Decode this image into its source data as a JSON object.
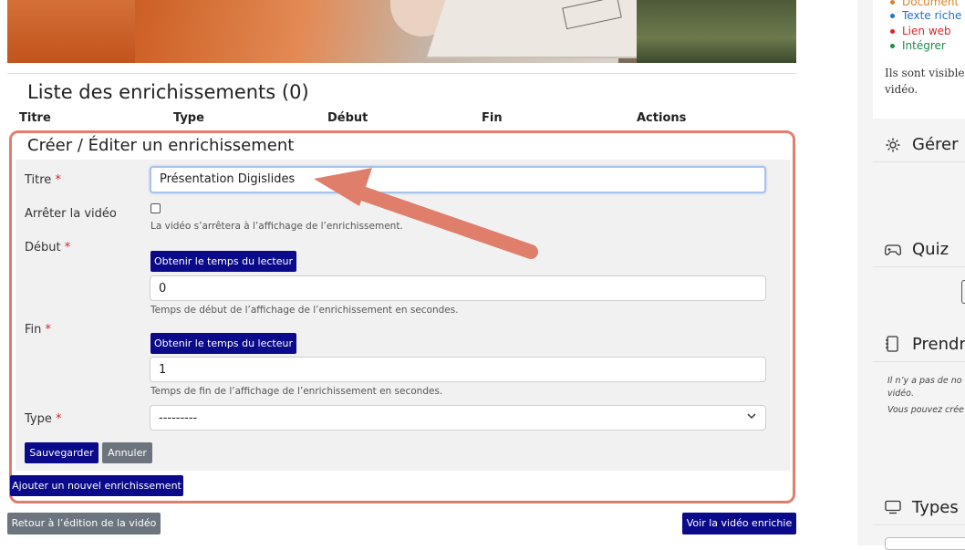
{
  "enrichments_list": {
    "title": "Liste des enrichissements (0)",
    "columns": [
      "Titre",
      "Type",
      "Début",
      "Fin",
      "Actions"
    ]
  },
  "form": {
    "title": "Créer / Éditer un enrichissement",
    "required_mark": "*",
    "titre_label": "Titre",
    "titre_value": "Présentation Digislides",
    "stop_video_label": "Arrêter la vidéo",
    "stop_video_help": "La vidéo s’arrêtera à l’affichage de l’enrichissement.",
    "debut_label": "Début",
    "get_time_label": "Obtenir le temps du lecteur",
    "debut_value": "0",
    "debut_help": "Temps de début de l’affichage de l’enrichissement en secondes.",
    "fin_label": "Fin",
    "fin_value": "1",
    "fin_help": "Temps de fin de l’affichage de l’enrichissement en secondes.",
    "type_label": "Type",
    "type_value": "---------",
    "save_label": "Sauvegarder",
    "cancel_label": "Annuler"
  },
  "add_enrichment_label": "Ajouter un nouvel enrichissement",
  "back_label": "Retour à l’édition de la vidéo",
  "view_enriched_label": "Voir la vidéo enrichie",
  "sidebar": {
    "legend": [
      {
        "label": "Document",
        "color": "#d9822b"
      },
      {
        "label": "Texte riche",
        "color": "#1f6fd1"
      },
      {
        "label": "Lien web",
        "color": "#d9232d"
      },
      {
        "label": "Intégrer",
        "color": "#1e8a4f"
      }
    ],
    "visible_text_1": "Ils sont visible",
    "visible_text_2": "vidéo.",
    "manage_heading": "Gérer",
    "quiz_heading": "Quiz",
    "notes_heading": "Prendr",
    "notes_text_1": "Il n’y a pas de no",
    "notes_text_2": "vidéo.",
    "notes_text_3": "Vous pouvez crée",
    "types_heading": "Types"
  },
  "colors": {
    "accent_navy": "#0a0a8a",
    "annotation": "#e07e6c",
    "gray_button": "#6c757d",
    "required": "#d9232d"
  }
}
